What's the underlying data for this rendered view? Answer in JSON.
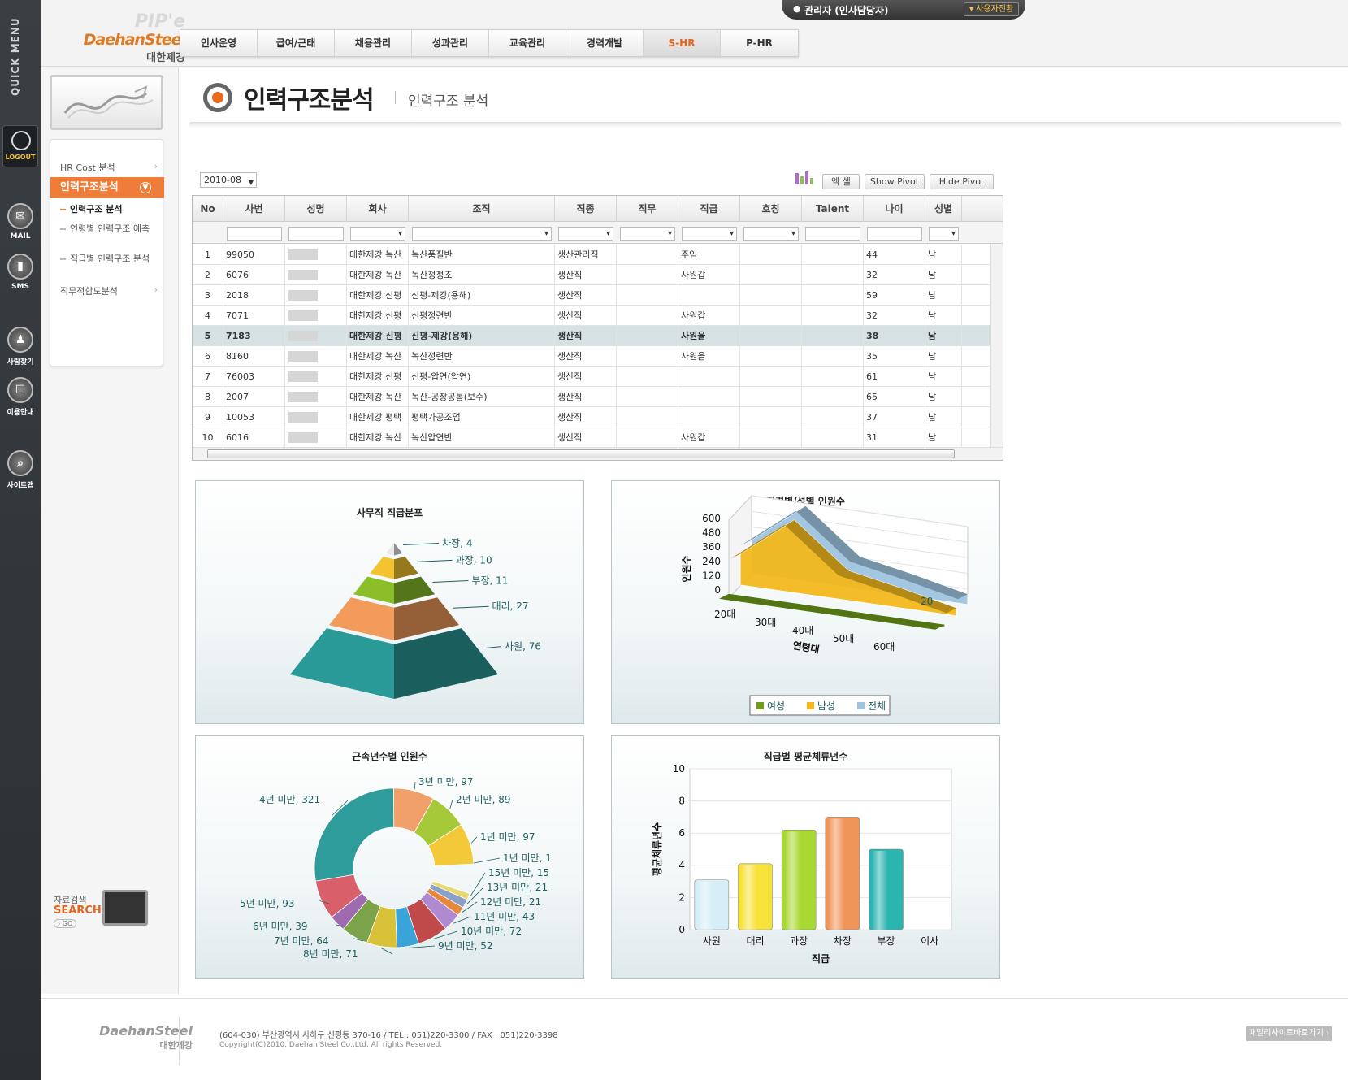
{
  "quick_menu": {
    "title": "QUICK MENU",
    "logout": "LOGOUT",
    "items": [
      {
        "label": "MAIL",
        "icon": "mail-icon"
      },
      {
        "label": "SMS",
        "icon": "sms-icon"
      },
      {
        "label": "사람찾기",
        "icon": "people-search-icon"
      },
      {
        "label": "이용안내",
        "icon": "guide-book-icon"
      },
      {
        "label": "사이트맵",
        "icon": "sitemap-search-icon"
      }
    ]
  },
  "header": {
    "logo_pipe": "PIP'e",
    "logo_eng": "DaehanSteel",
    "logo_kor": "대한제강",
    "user": "관리자 (인사담당자)",
    "switch_user": "사용자전환",
    "nav": [
      "인사운영",
      "급여/근태",
      "채용관리",
      "성과관리",
      "교육관리",
      "경력개발",
      "S-HR",
      "P-HR"
    ],
    "active_nav": "S-HR"
  },
  "sidebar": {
    "items": [
      {
        "label": "HR Cost 분석"
      },
      {
        "label": "인력구조분석"
      },
      {
        "label": "직무적합도분석"
      }
    ],
    "subitems": [
      "인력구조 분석",
      "연령별 인력구조 예측",
      "직급별 인력구조 분석"
    ],
    "search_label": "자료검색",
    "search_title": "SEARCH",
    "search_go": "GO"
  },
  "page": {
    "title": "인력구조분석",
    "subtitle": "인력구조 분석",
    "date": "2010-08",
    "buttons": {
      "excel": "엑 셀",
      "show_pivot": "Show Pivot",
      "hide_pivot": "Hide Pivot"
    }
  },
  "grid": {
    "columns": [
      "No",
      "사번",
      "성명",
      "회사",
      "조직",
      "직종",
      "직무",
      "직급",
      "호칭",
      "Talent",
      "나이",
      "성별"
    ],
    "rows": [
      [
        "1",
        "99050",
        "",
        "대한제강 녹산",
        "녹산품질반",
        "생산관리직",
        "",
        "주임",
        "",
        "",
        "44",
        "남"
      ],
      [
        "2",
        "6076",
        "",
        "대한제강 녹산",
        "녹산정정조",
        "생산직",
        "",
        "사원갑",
        "",
        "",
        "32",
        "남"
      ],
      [
        "3",
        "2018",
        "",
        "대한제강 신평",
        "신평-제강(용해)",
        "생산직",
        "",
        "",
        "",
        "",
        "59",
        "남"
      ],
      [
        "4",
        "7071",
        "",
        "대한제강 신평",
        "신평정련반",
        "생산직",
        "",
        "사원갑",
        "",
        "",
        "32",
        "남"
      ],
      [
        "5",
        "7183",
        "",
        "대한제강 신평",
        "신평-제강(용해)",
        "생산직",
        "",
        "사원을",
        "",
        "",
        "38",
        "남"
      ],
      [
        "6",
        "8160",
        "",
        "대한제강 녹산",
        "녹산정련반",
        "생산직",
        "",
        "사원을",
        "",
        "",
        "35",
        "남"
      ],
      [
        "7",
        "76003",
        "",
        "대한제강 신평",
        "신평-압연(압연)",
        "생산직",
        "",
        "",
        "",
        "",
        "61",
        "남"
      ],
      [
        "8",
        "2007",
        "",
        "대한제강 녹산",
        "녹산-공장공통(보수)",
        "생산직",
        "",
        "",
        "",
        "",
        "65",
        "남"
      ],
      [
        "9",
        "10053",
        "",
        "대한제강 평택",
        "평택가공조업",
        "생산직",
        "",
        "",
        "",
        "",
        "37",
        "남"
      ],
      [
        "10",
        "6016",
        "",
        "대한제강 녹산",
        "녹산압연반",
        "생산직",
        "",
        "사원갑",
        "",
        "",
        "31",
        "남"
      ]
    ],
    "highlighted_row": 4
  },
  "chart_data": [
    {
      "type": "pyramid",
      "title": "사무직 직급분포",
      "categories": [
        "차장",
        "과장",
        "부장",
        "대리",
        "사원"
      ],
      "values": [
        4,
        10,
        11,
        27,
        76
      ],
      "colors": [
        "#e9e9e9",
        "#f4c430",
        "#8bbf2a",
        "#f29b5b",
        "#2a9a98"
      ]
    },
    {
      "type": "area",
      "title": "연령별/성별 인원수",
      "categories": [
        "20대",
        "30대",
        "40대",
        "50대",
        "60대"
      ],
      "series": [
        {
          "name": "여성",
          "values": [
            20,
            20,
            20,
            20,
            20
          ],
          "color": "#6f9d1a"
        },
        {
          "name": "남성",
          "values": [
            240,
            560,
            230,
            150,
            60
          ],
          "color": "#f2b81c"
        },
        {
          "name": "전체",
          "values": [
            260,
            580,
            250,
            170,
            80
          ],
          "color": "#9fc4df"
        }
      ],
      "xlabel": "연령대",
      "ylabel": "인원수",
      "yticks": [
        "0",
        "120",
        "240",
        "360",
        "480",
        "600"
      ],
      "value_label": "20",
      "legend_position": "bottom"
    },
    {
      "type": "pie",
      "title": "근속년수별 인원수",
      "categories": [
        "1년 미만",
        "2년 미만",
        "3년 미만",
        "4년 미만",
        "5년 미만",
        "6년 미만",
        "7년 미만",
        "8년 미만",
        "9년 미만",
        "10년 미만",
        "11년 미만",
        "12년 미만",
        "13년 미만",
        "15년 미만"
      ],
      "values": [
        97,
        89,
        97,
        321,
        93,
        39,
        64,
        71,
        52,
        72,
        43,
        21,
        21,
        15
      ],
      "extra_labels": [
        "1년 미만, 1"
      ]
    },
    {
      "type": "bar",
      "title": "직급별 평균체류년수",
      "categories": [
        "사원",
        "대리",
        "과장",
        "차장",
        "부장",
        "이사"
      ],
      "values": [
        3.1,
        4.1,
        6.2,
        7.0,
        5.0,
        0
      ],
      "colors": [
        "#d6eef8",
        "#f7e23a",
        "#a8d832",
        "#f0955a",
        "#2bb5b0",
        "#cccccc"
      ],
      "xlabel": "직급",
      "ylabel": "평균체류년수",
      "ylim": [
        0,
        10
      ],
      "yticks": [
        "0",
        "2",
        "4",
        "6",
        "8",
        "10"
      ]
    }
  ],
  "footer": {
    "logo_eng": "DaehanSteel",
    "logo_kor": "대한제강",
    "address": "(604-030) 부산광역시 사하구 신평동 370-16   /   TEL : 051)220-3300   /   FAX : 051)220-3398",
    "copyright": "Copyright(C)2010, Daehan Steel Co.,Ltd. All rights Reserved.",
    "family_site": "패밀리사이트바로가기 ›"
  }
}
